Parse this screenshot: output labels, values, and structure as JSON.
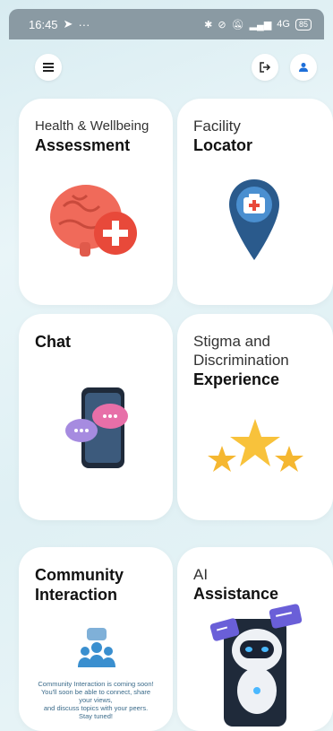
{
  "status_bar": {
    "time": "16:45",
    "signal_text": "4G",
    "battery": "85"
  },
  "toolbar": {
    "menu_icon": "hamburger-icon",
    "logout_icon": "logout-icon",
    "profile_icon": "person-icon"
  },
  "cards": {
    "assessment": {
      "line1": "Health & Wellbeing",
      "line2": "Assessment"
    },
    "locator": {
      "line1": "Facility",
      "line2": "Locator"
    },
    "chat": {
      "line1": "Chat"
    },
    "stigma": {
      "line1": "Stigma and",
      "line1b": "Discrimination",
      "line2": "Experience"
    },
    "community": {
      "line1": "Community",
      "line2": "Interaction",
      "note1": "Community Interaction is coming soon!",
      "note2": "You'll soon be able to connect, share",
      "note3": "your views,",
      "note4": "and discuss topics with your peers.",
      "note5": "Stay tuned!"
    },
    "ai": {
      "line1": "AI",
      "line2": "Assistance"
    }
  },
  "colors": {
    "brain": "#f06a5a",
    "pin": "#2a5a8c",
    "star": "#f5b731",
    "bubble": "#c48ad8",
    "community": "#3a8fcf"
  }
}
